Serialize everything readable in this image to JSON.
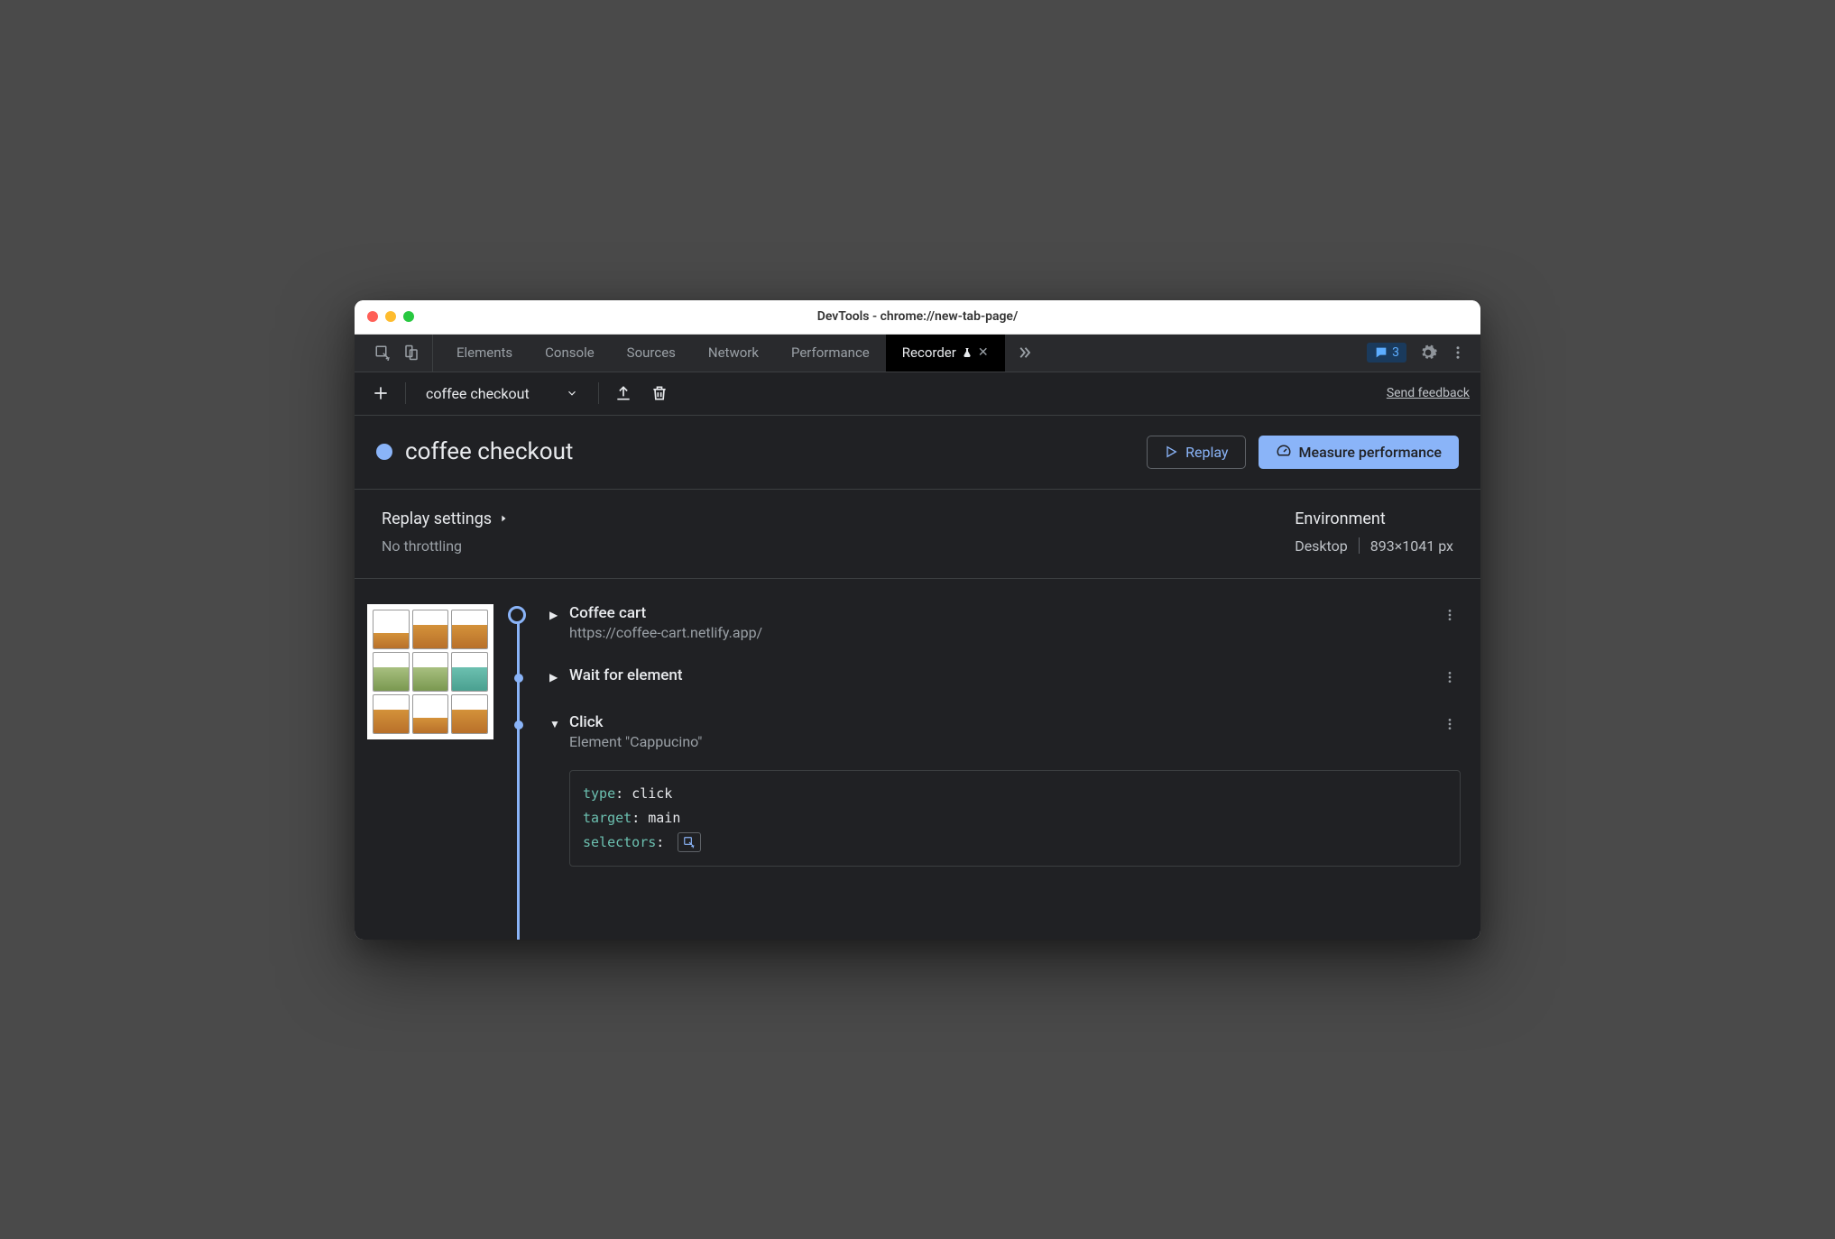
{
  "window": {
    "title": "DevTools - chrome://new-tab-page/"
  },
  "tabs": {
    "items": [
      "Elements",
      "Console",
      "Sources",
      "Network",
      "Performance",
      "Recorder"
    ],
    "active": "Recorder",
    "message_count": "3"
  },
  "toolbar": {
    "recording_name": "coffee checkout",
    "feedback": "Send feedback"
  },
  "header": {
    "title": "coffee checkout",
    "replay_label": "Replay",
    "measure_label": "Measure performance"
  },
  "settings": {
    "replay_label": "Replay settings",
    "throttling": "No throttling",
    "env_label": "Environment",
    "env_device": "Desktop",
    "env_size": "893×1041 px"
  },
  "steps": {
    "s0": {
      "title": "Coffee cart",
      "url": "https://coffee-cart.netlify.app/"
    },
    "s1": {
      "title": "Wait for element"
    },
    "s2": {
      "title": "Click",
      "sub": "Element \"Cappucino\"",
      "code": {
        "k0": "type",
        "v0": "click",
        "k1": "target",
        "v1": "main",
        "k2": "selectors"
      }
    }
  }
}
